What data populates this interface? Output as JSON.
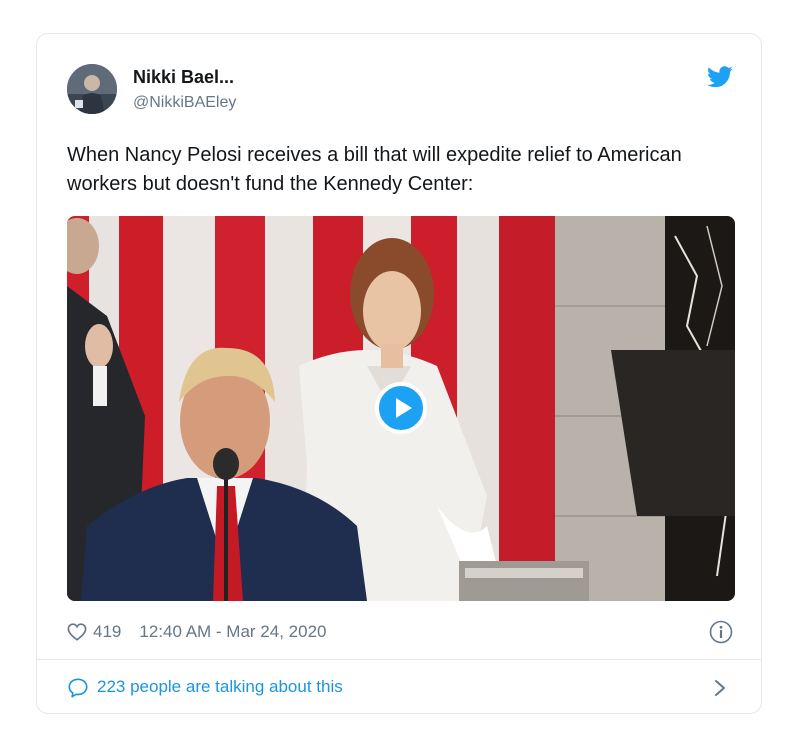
{
  "tweet": {
    "author_name": "Nikki Bael...",
    "author_handle": "@NikkiBAEley",
    "text": "When Nancy Pelosi receives a bill that will expedite relief to American workers but doesn't fund the Kennedy Center:",
    "likes": "419",
    "timestamp": "12:40 AM - Mar 24, 2020",
    "conversation_label": "223 people are talking about this"
  },
  "icons": {
    "brand": "twitter-bird-icon",
    "like": "heart-icon",
    "info": "info-icon",
    "conversation": "speech-bubble-icon",
    "expand": "chevron-right-icon",
    "media_play": "play-icon"
  },
  "colors": {
    "accent": "#1da1f2",
    "link": "#1b95e0",
    "secondary_text": "#657786",
    "primary_text": "#14171a",
    "border": "#e1e8ed"
  }
}
